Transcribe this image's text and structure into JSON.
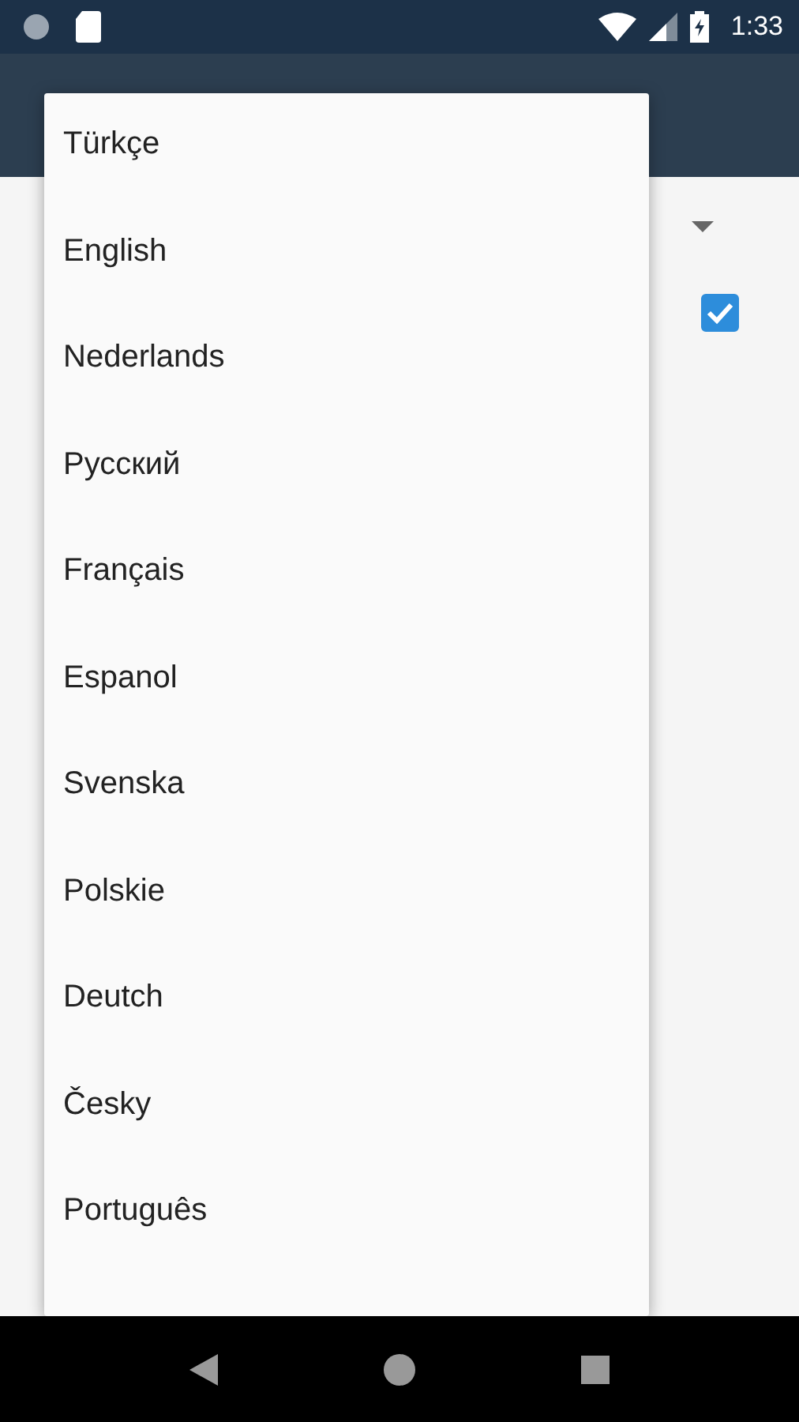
{
  "status_bar": {
    "time": "1:33"
  },
  "settings": {
    "checkbox": {
      "checked": true
    }
  },
  "language_menu": {
    "items": [
      {
        "label": "Türkçe"
      },
      {
        "label": "English"
      },
      {
        "label": "Nederlands"
      },
      {
        "label": "Русский"
      },
      {
        "label": "Français"
      },
      {
        "label": "Espanol"
      },
      {
        "label": "Svenska"
      },
      {
        "label": "Polskie"
      },
      {
        "label": "Deutch"
      },
      {
        "label": "Česky"
      },
      {
        "label": "Português"
      }
    ]
  }
}
